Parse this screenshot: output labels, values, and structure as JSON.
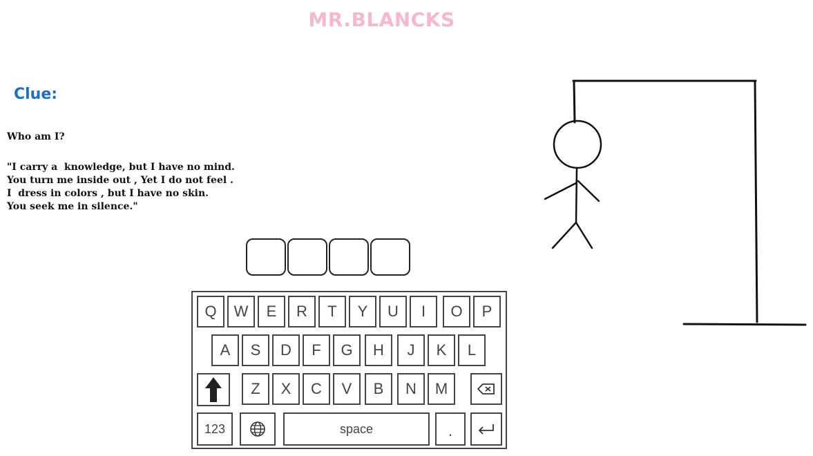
{
  "title": "MR.BLANCKS",
  "clue": {
    "heading": "Clue:",
    "question": "Who am I?",
    "riddle_lines": [
      "\"I carry a  knowledge, but I have no mind.",
      "You turn me inside out , Yet I do not feel .",
      "I  dress in colors , but I have no skin.",
      "You seek me in silence.\""
    ]
  },
  "answer_slots": [
    "",
    "",
    "",
    ""
  ],
  "keyboard": {
    "row1": [
      "Q",
      "W",
      "E",
      "R",
      "T",
      "Y",
      "U",
      "I",
      "O",
      "P"
    ],
    "row2": [
      "A",
      "S",
      "D",
      "F",
      "G",
      "H",
      "J",
      "K",
      "L"
    ],
    "row3": [
      "Z",
      "X",
      "C",
      "V",
      "B",
      "N",
      "M"
    ],
    "shift_icon": "shift-arrow-icon",
    "backspace_icon": "backspace-icon",
    "numbers_label": "123",
    "globe_icon": "globe-icon",
    "space_label": "space",
    "period_label": ".",
    "enter_icon": "enter-icon"
  },
  "hangman": {
    "parts_shown": [
      "head",
      "body",
      "left-arm",
      "right-arm",
      "left-leg",
      "right-leg"
    ]
  }
}
